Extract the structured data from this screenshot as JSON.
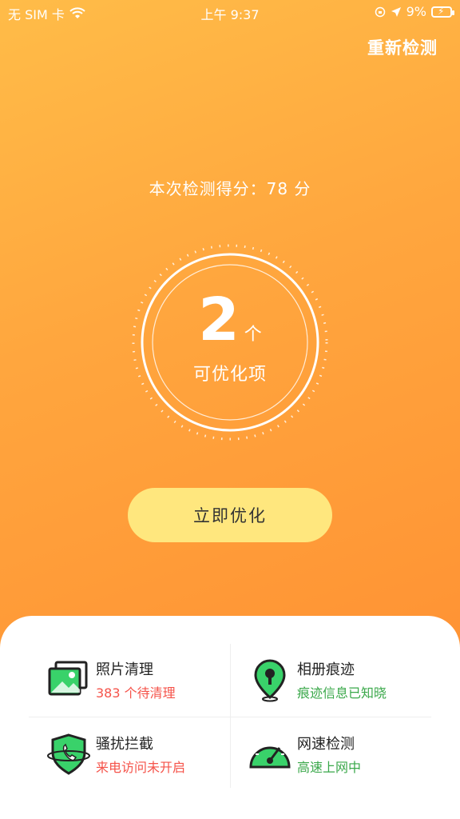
{
  "status_bar": {
    "carrier": "无 SIM 卡",
    "time": "上午 9:37",
    "battery": "9%"
  },
  "header": {
    "recheck_label": "重新检测"
  },
  "score": {
    "text": "本次检测得分：78 分"
  },
  "summary": {
    "count": "2",
    "unit": "个",
    "label": "可优化项"
  },
  "action": {
    "optimize_label": "立即优化"
  },
  "features": [
    {
      "title": "照片清理",
      "subtitle": "383 个待清理",
      "icon": "photo-icon"
    },
    {
      "title": "相册痕迹",
      "subtitle": "痕迹信息已知晓",
      "icon": "location-pin-icon"
    },
    {
      "title": "骚扰拦截",
      "subtitle": "来电访问未开启",
      "icon": "phone-shield-icon"
    },
    {
      "title": "网速检测",
      "subtitle": "高速上网中",
      "icon": "speedometer-icon"
    }
  ],
  "colors": {
    "hero_top": "#ffbc48",
    "hero_bottom": "#ff9334",
    "button": "#ffe77e",
    "red": "#f5534a",
    "green": "#3aa84a"
  }
}
